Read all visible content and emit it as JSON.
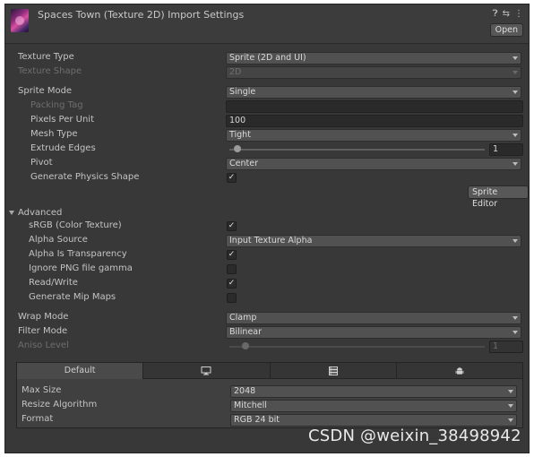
{
  "header": {
    "title": "Spaces Town (Texture 2D) Import Settings",
    "icons": [
      "help-icon",
      "preset-icon",
      "menu-icon"
    ],
    "open_label": "Open"
  },
  "texture": {
    "type_label": "Texture Type",
    "type_value": "Sprite (2D and UI)",
    "shape_label": "Texture Shape",
    "shape_value": "2D"
  },
  "sprite": {
    "mode_label": "Sprite Mode",
    "mode_value": "Single",
    "packing_tag_label": "Packing Tag",
    "packing_tag_value": "",
    "ppu_label": "Pixels Per Unit",
    "ppu_value": "100",
    "mesh_type_label": "Mesh Type",
    "mesh_type_value": "Tight",
    "extrude_label": "Extrude Edges",
    "extrude_value": "1",
    "extrude_min": 0,
    "extrude_max": 32,
    "pivot_label": "Pivot",
    "pivot_value": "Center",
    "physics_label": "Generate Physics Shape",
    "physics_checked": true,
    "editor_button": "Sprite Editor"
  },
  "advanced": {
    "label": "Advanced",
    "srgb_label": "sRGB (Color Texture)",
    "srgb_checked": true,
    "alpha_source_label": "Alpha Source",
    "alpha_source_value": "Input Texture Alpha",
    "alpha_transp_label": "Alpha Is Transparency",
    "alpha_transp_checked": true,
    "ignore_gamma_label": "Ignore PNG file gamma",
    "ignore_gamma_checked": false,
    "readwrite_label": "Read/Write",
    "readwrite_checked": true,
    "mipmaps_label": "Generate Mip Maps",
    "mipmaps_checked": false
  },
  "wrap": {
    "label": "Wrap Mode",
    "value": "Clamp"
  },
  "filter": {
    "label": "Filter Mode",
    "value": "Bilinear"
  },
  "aniso": {
    "label": "Aniso Level",
    "value": "1",
    "min": 0,
    "max": 16
  },
  "platform": {
    "tabs": [
      {
        "label": "Default",
        "icon": null
      },
      {
        "label": "",
        "icon": "monitor-icon"
      },
      {
        "label": "",
        "icon": "server-icon"
      },
      {
        "label": "",
        "icon": "android-icon"
      }
    ],
    "max_size_label": "Max Size",
    "max_size_value": "2048",
    "resize_label": "Resize Algorithm",
    "resize_value": "Mitchell",
    "format_label": "Format",
    "format_value": "RGB 24 bit"
  },
  "watermark": "CSDN @weixin_38498942"
}
